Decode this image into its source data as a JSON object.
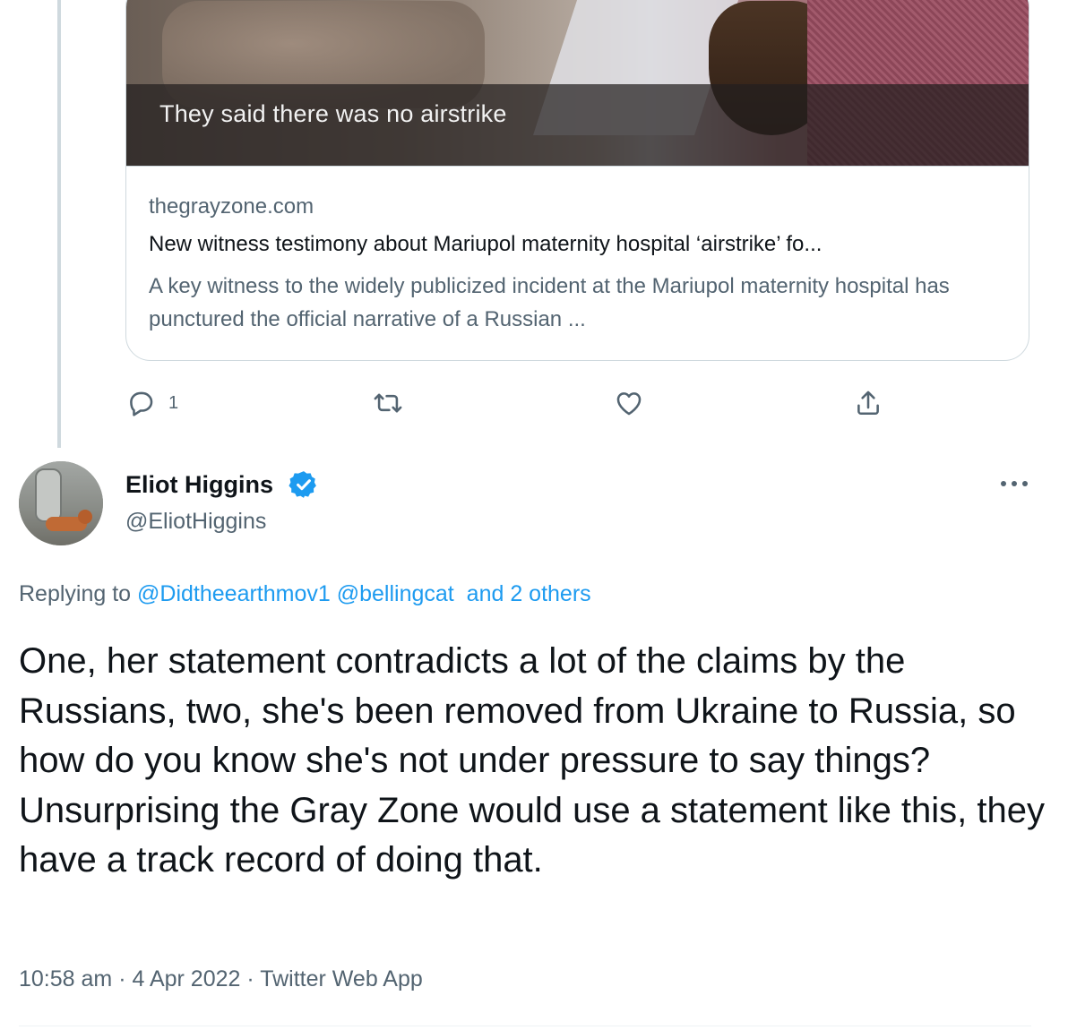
{
  "embedded_card": {
    "image_caption": "They said there was no airstrike",
    "domain": "thegrayzone.com",
    "title": "New witness testimony about Mariupol maternity hospital ‘airstrike’ fo...",
    "description": "A key witness to the widely publicized incident at the Mariupol maternity hospital has punctured the official narrative of a Russian ..."
  },
  "parent_actions": {
    "reply_icon": "reply-icon",
    "reply_count": "1",
    "retweet_icon": "retweet-icon",
    "like_icon": "heart-icon",
    "share_icon": "share-icon"
  },
  "tweet": {
    "author_name": "Eliot Higgins",
    "verified": true,
    "verified_color": "#1d9bf0",
    "handle": "@EliotHiggins",
    "replying_prefix": "Replying to",
    "replying_users": [
      "@Didtheearthmov1",
      "@bellingcat"
    ],
    "replying_others": "and 2 others",
    "text": "One, her statement contradicts a lot of the claims by the Russians, two, she's been removed from Ukraine to Russia, so how do you know she's not under pressure to say things? Unsurprising the Gray Zone would use a statement like this, they have a track record of doing that.",
    "time": "10:58 am",
    "separator": "·",
    "date": "4 Apr 2022",
    "source": "Twitter Web App"
  },
  "colors": {
    "text_primary": "#0f1419",
    "text_secondary": "#536471",
    "link": "#1d9bf0",
    "border": "#cfd9de"
  }
}
